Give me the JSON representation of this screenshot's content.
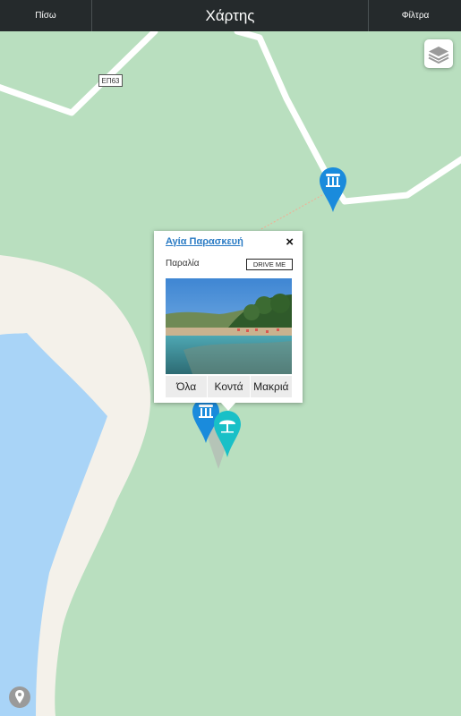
{
  "header": {
    "back_label": "Πίσω",
    "title": "Χάρτης",
    "filters_label": "Φίλτρα"
  },
  "map": {
    "road_label": "ΕΠ63",
    "colors": {
      "land": "#b9dfbf",
      "sand": "#f4f1ea",
      "water": "#a9d4f7",
      "road": "#ffffff",
      "pin_blue": "#1a8bdc",
      "pin_teal": "#19c0c7"
    },
    "markers": [
      {
        "name": "ancient-site-marker",
        "icon": "column-icon",
        "color": "#1a8bdc"
      },
      {
        "name": "ancient-site-marker",
        "icon": "column-icon",
        "color": "#1a8bdc"
      },
      {
        "name": "beach-marker",
        "icon": "umbrella-icon",
        "color": "#19c0c7"
      }
    ]
  },
  "popup": {
    "title": "Αγία Παρασκευή",
    "category": "Παραλία",
    "drive_label": "DRIVE ME",
    "close_label": "×",
    "tabs": [
      "Όλα",
      "Κοντά",
      "Μακριά"
    ]
  }
}
